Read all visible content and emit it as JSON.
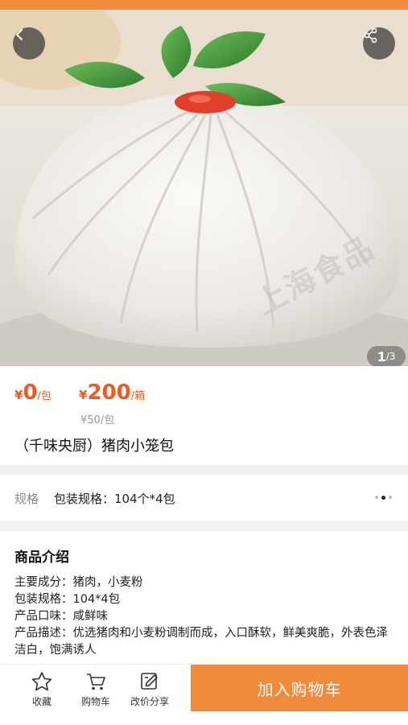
{
  "nav": {
    "back_icon": "back-icon",
    "share_icon": "share-icon"
  },
  "gallery": {
    "current": "1",
    "total": "/3",
    "watermark": "上海食品"
  },
  "price": {
    "currency": "¥",
    "unit_price": "0",
    "unit_price_unit": "/包",
    "box_price": "200",
    "box_price_unit": "/箱",
    "per_pack": "¥50/包"
  },
  "product": {
    "title": "（千味央厨）猪肉小笼包"
  },
  "spec": {
    "label": "规格",
    "value": "包装规格：104个*4包"
  },
  "intro": {
    "heading": "商品介绍",
    "lines": [
      "主要成分：猪肉，小麦粉",
      "包装规格：104*4包",
      "产品口味：咸鲜味",
      "产品描述：优选猪肉和小麦粉调制而成，入口酥软，鲜美爽脆，外表色泽洁白，饱满诱人"
    ]
  },
  "footer": {
    "favorite": "收藏",
    "cart": "购物车",
    "share_price": "改价分享",
    "add_to_cart": "加入购物车"
  },
  "colors": {
    "accent": "#f08a3c",
    "price": "#ef5a22"
  }
}
